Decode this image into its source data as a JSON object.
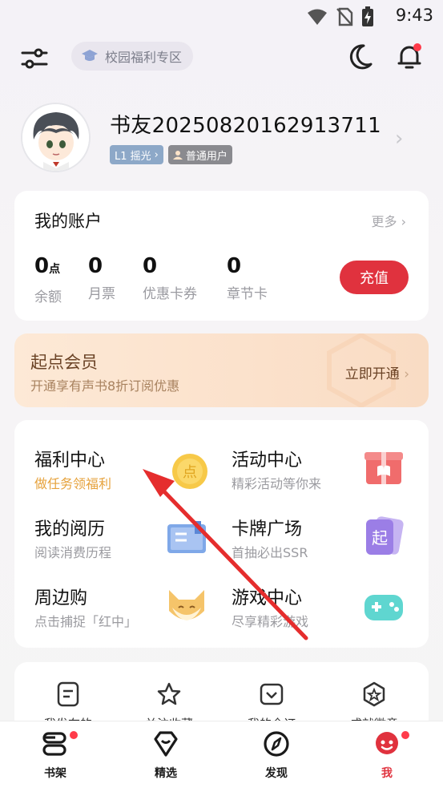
{
  "status_bar": {
    "time": "9:43"
  },
  "topbar": {
    "campus_label": "校园福利专区"
  },
  "profile": {
    "username": "书友20250820162913711",
    "level_badge": "L1 摇光",
    "user_type": "普通用户"
  },
  "account": {
    "title": "我的账户",
    "more": "更多",
    "stats": [
      {
        "value": "0",
        "unit": "点",
        "label": "余额"
      },
      {
        "value": "0",
        "unit": "",
        "label": "月票"
      },
      {
        "value": "0",
        "unit": "",
        "label": "优惠卡券"
      },
      {
        "value": "0",
        "unit": "",
        "label": "章节卡"
      }
    ],
    "recharge": "充值"
  },
  "vip": {
    "title": "起点会员",
    "subtitle": "开通享有声书8折订阅优惠",
    "open": "立即开通"
  },
  "services": [
    {
      "title": "福利中心",
      "sub": "做任务领福利",
      "icon": "coin-icon"
    },
    {
      "title": "活动中心",
      "sub": "精彩活动等你来",
      "icon": "gift-icon"
    },
    {
      "title": "我的阅历",
      "sub": "阅读消费历程",
      "icon": "book-icon"
    },
    {
      "title": "卡牌广场",
      "sub": "首抽必出SSR",
      "icon": "card-icon"
    },
    {
      "title": "周边购",
      "sub": "点击捕捉「红中」",
      "icon": "fox-icon"
    },
    {
      "title": "游戏中心",
      "sub": "尽享精彩游戏",
      "icon": "gamepad-icon"
    }
  ],
  "quick": [
    {
      "label": "我发布的",
      "icon": "document-icon"
    },
    {
      "label": "关注收藏",
      "icon": "star-icon"
    },
    {
      "label": "我的全订",
      "icon": "heart-box-icon"
    },
    {
      "label": "成就徽章",
      "icon": "badge-icon"
    }
  ],
  "nav": [
    {
      "label": "书架",
      "icon": "bookshelf-icon"
    },
    {
      "label": "精选",
      "icon": "diamond-icon"
    },
    {
      "label": "发现",
      "icon": "compass-icon"
    },
    {
      "label": "我",
      "icon": "me-icon"
    }
  ],
  "colors": {
    "accent": "#e0323e",
    "gold": "#e6a23c",
    "vip_text": "#6b4326"
  }
}
